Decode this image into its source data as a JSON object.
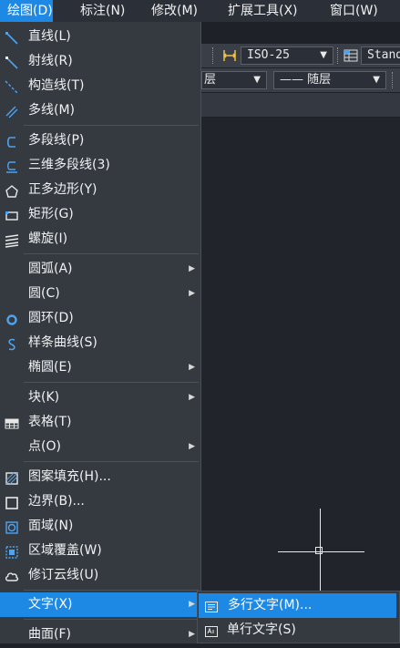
{
  "menubar": {
    "items": [
      "绘图(D)",
      "标注(N)",
      "修改(M)",
      "扩展工具(X)",
      "窗口(W)"
    ]
  },
  "toolbar": {
    "dimstyle_value": "ISO-25",
    "textstyle_value": "Stand",
    "linetype_value": "—— 随层",
    "layer_partial": "层"
  },
  "draw_menu": {
    "items": [
      {
        "label": "直线(L)",
        "icon": "line-icon"
      },
      {
        "label": "射线(R)",
        "icon": "ray-icon"
      },
      {
        "label": "构造线(T)",
        "icon": "construction-line-icon"
      },
      {
        "label": "多线(M)",
        "icon": "multiline-icon"
      },
      {
        "label": "多段线(P)",
        "icon": "polyline-icon"
      },
      {
        "label": "三维多段线(3)",
        "icon": "3d-polyline-icon"
      },
      {
        "label": "正多边形(Y)",
        "icon": "polygon-icon"
      },
      {
        "label": "矩形(G)",
        "icon": "rectangle-icon"
      },
      {
        "label": "螺旋(I)",
        "icon": "helix-icon"
      },
      {
        "label": "圆弧(A)",
        "icon": "",
        "submenu": true
      },
      {
        "label": "圆(C)",
        "icon": "",
        "submenu": true
      },
      {
        "label": "圆环(D)",
        "icon": "donut-icon"
      },
      {
        "label": "样条曲线(S)",
        "icon": "spline-icon"
      },
      {
        "label": "椭圆(E)",
        "icon": "",
        "submenu": true
      },
      {
        "label": "块(K)",
        "icon": "",
        "submenu": true
      },
      {
        "label": "表格(T)",
        "icon": "table-icon"
      },
      {
        "label": "点(O)",
        "icon": "",
        "submenu": true
      },
      {
        "label": "图案填充(H)...",
        "icon": "hatch-icon"
      },
      {
        "label": "边界(B)...",
        "icon": "boundary-icon"
      },
      {
        "label": "面域(N)",
        "icon": "region-icon"
      },
      {
        "label": "区域覆盖(W)",
        "icon": "wipeout-icon"
      },
      {
        "label": "修订云线(U)",
        "icon": "revcloud-icon"
      },
      {
        "label": "文字(X)",
        "icon": "",
        "submenu": true,
        "highlighted": true
      },
      {
        "label": "曲面(F)",
        "icon": "",
        "submenu": true
      }
    ]
  },
  "text_submenu": {
    "items": [
      {
        "label": "多行文字(M)...",
        "icon": "mtext-icon",
        "highlighted": true
      },
      {
        "label": "单行文字(S)",
        "icon": "single-line-text-icon"
      }
    ]
  },
  "colors": {
    "highlight": "#1e88e5",
    "menu_bg": "#353a41",
    "icon_blue": "#4ea3f0"
  }
}
